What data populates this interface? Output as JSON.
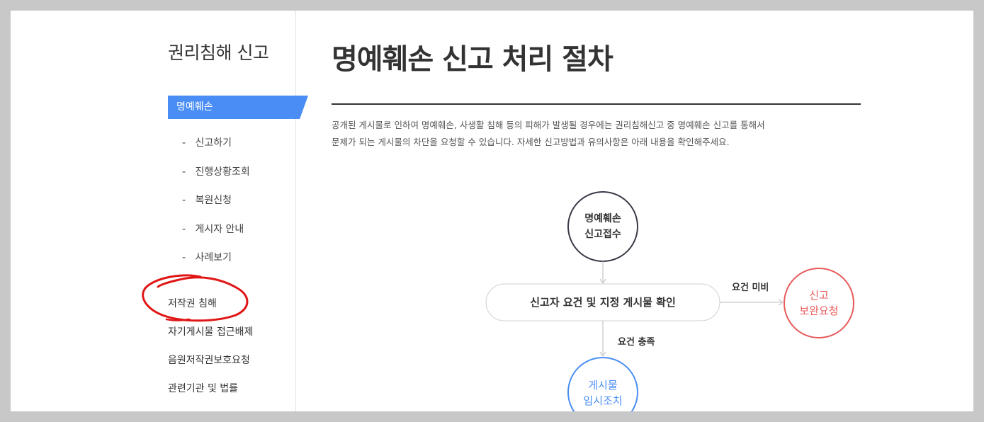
{
  "sidebar": {
    "title": "권리침해 신고",
    "active_item": "명예훼손",
    "sub_items": [
      {
        "dash": "-",
        "label": "신고하기"
      },
      {
        "dash": "-",
        "label": "진행상황조회"
      },
      {
        "dash": "-",
        "label": "복원신청"
      },
      {
        "dash": "-",
        "label": "게시자 안내"
      },
      {
        "dash": "-",
        "label": "사례보기"
      }
    ],
    "items": [
      {
        "label": "저작권 침해"
      },
      {
        "label": "자기게시물 접근배제"
      },
      {
        "label": "음원저작권보호요청"
      },
      {
        "label": "관련기관 및 법률"
      }
    ]
  },
  "main": {
    "title": "명예훼손 신고 처리 절차",
    "intro_lines": [
      "공개된 게시물로 인하여 명예훼손, 사생활 침해 등의 피해가 발생될 경우에는 권리침해신고 중 명예훼손 신고를 통해서",
      "문제가 되는 게시물의 차단을 요청할 수 있습니다. 자세한 신고방법과 유의사항은 아래 내용을 확인해주세요."
    ]
  },
  "flow": {
    "step1": {
      "line1": "명예훼손",
      "line2": "신고접수"
    },
    "step2": {
      "label": "신고자 요건 및 지정 게시물 확인"
    },
    "branch_fail_label": "요건 미비",
    "fail_node": {
      "line1": "신고",
      "line2": "보완요청"
    },
    "branch_ok_label": "요건 충족",
    "ok_node": {
      "line1": "게시물",
      "line2": "임시조치"
    }
  },
  "colors": {
    "accent_blue": "#4a8ef5",
    "alert_red": "#e85a5a",
    "annotation_red": "#e01515",
    "dark_circle": "#3a3a48"
  }
}
